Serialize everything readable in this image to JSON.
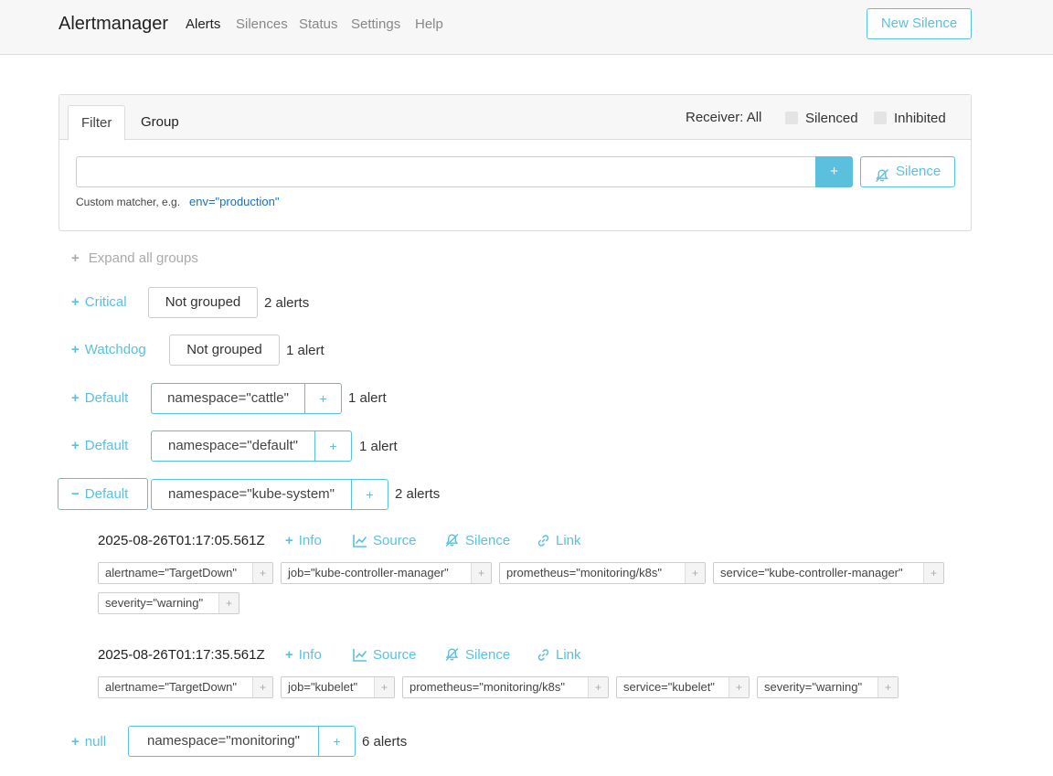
{
  "navbar": {
    "brand": "Alertmanager",
    "items": [
      {
        "label": "Alerts"
      },
      {
        "label": "Silences"
      },
      {
        "label": "Status"
      },
      {
        "label": "Settings"
      },
      {
        "label": "Help"
      }
    ],
    "new_silence_label": "New Silence"
  },
  "filter_card": {
    "tabs": [
      {
        "label": "Filter"
      },
      {
        "label": "Group"
      }
    ],
    "receiver_label": "Receiver: All",
    "silenced_label": "Silenced",
    "inhibited_label": "Inhibited",
    "input_value": "",
    "add_label": "+",
    "silence_label": "Silence",
    "hint": "Custom matcher, e.g.",
    "hint_example": "env=\"production\""
  },
  "expand_all": {
    "icon": "+",
    "label": "Expand all groups"
  },
  "groups": [
    {
      "toggle_icon": "+",
      "receiver": "Critical",
      "chip": "Not grouped",
      "count": "2 alerts"
    },
    {
      "toggle_icon": "+",
      "receiver": "Watchdog",
      "chip": "Not grouped",
      "count": "1 alert"
    },
    {
      "toggle_icon": "+",
      "receiver": "Default",
      "chip": "namespace=\"cattle\"",
      "chip_add": "+",
      "count": "1 alert"
    },
    {
      "toggle_icon": "+",
      "receiver": "Default",
      "chip": "namespace=\"default\"",
      "chip_add": "+",
      "count": "1 alert"
    },
    {
      "toggle_icon": "−",
      "receiver": "Default",
      "chip": "namespace=\"kube-system\"",
      "chip_add": "+",
      "count": "2 alerts"
    },
    {
      "toggle_icon": "+",
      "receiver": "null",
      "chip": "namespace=\"monitoring\"",
      "chip_add": "+",
      "count": "6 alerts"
    }
  ],
  "alerts": [
    {
      "time": "2025-08-26T01:17:05.561Z",
      "actions": {
        "info": "Info",
        "source": "Source",
        "silence": "Silence",
        "link": "Link"
      },
      "labels": [
        "alertname=\"TargetDown\"",
        "job=\"kube-controller-manager\"",
        "prometheus=\"monitoring/k8s\"",
        "service=\"kube-controller-manager\"",
        "severity=\"warning\""
      ]
    },
    {
      "time": "2025-08-26T01:17:35.561Z",
      "actions": {
        "info": "Info",
        "source": "Source",
        "silence": "Silence",
        "link": "Link"
      },
      "labels": [
        "alertname=\"TargetDown\"",
        "job=\"kubelet\"",
        "prometheus=\"monitoring/k8s\"",
        "service=\"kubelet\"",
        "severity=\"warning\""
      ]
    }
  ],
  "label_add": "+",
  "colors": {
    "accent": "#5bc0de",
    "link": "#1f6fb5",
    "header_bg": "#f7f7f7",
    "border": "#dcdcdc"
  },
  "icons": [
    "silence-off-icon",
    "chart-line-icon",
    "link-icon",
    "plus-icon",
    "minus-icon"
  ]
}
